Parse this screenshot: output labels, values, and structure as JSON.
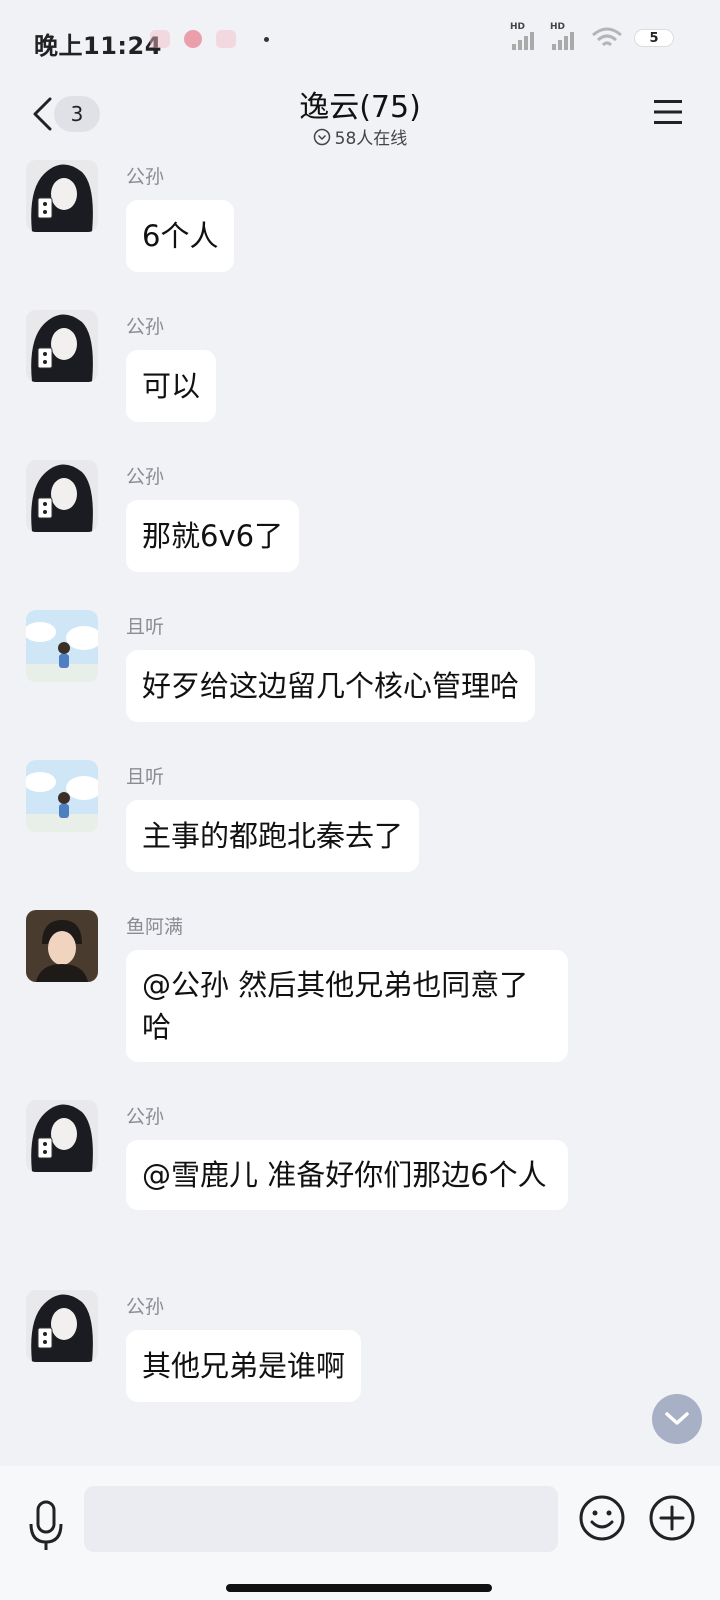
{
  "status_bar": {
    "time": "晚上11:24",
    "sim1_label": "HD",
    "sim2_label": "HD",
    "battery": "5"
  },
  "header": {
    "unread_count": "3",
    "title": "逸云(75)",
    "online": "58人在线"
  },
  "messages": [
    {
      "sender": "公孙",
      "text": "6个人"
    },
    {
      "sender": "公孙",
      "text": "可以"
    },
    {
      "sender": "公孙",
      "text": "那就6v6了"
    },
    {
      "sender": "且听",
      "text": "好歹给这边留几个核心管理哈"
    },
    {
      "sender": "且听",
      "text": "主事的都跑北秦去了"
    },
    {
      "sender": "鱼阿满",
      "text": "@公孙 然后其他兄弟也同意了哈"
    },
    {
      "sender": "公孙",
      "text": "@雪鹿儿 准备好你们那边6个人"
    },
    {
      "sender": "公孙",
      "text": "其他兄弟是谁啊"
    }
  ],
  "input": {
    "placeholder": "",
    "value": ""
  },
  "colors": {
    "background": "#f1f2f6",
    "bubble": "#ffffff",
    "sender_name": "#8a8c93",
    "scroll_button": "#a7b0c5"
  }
}
